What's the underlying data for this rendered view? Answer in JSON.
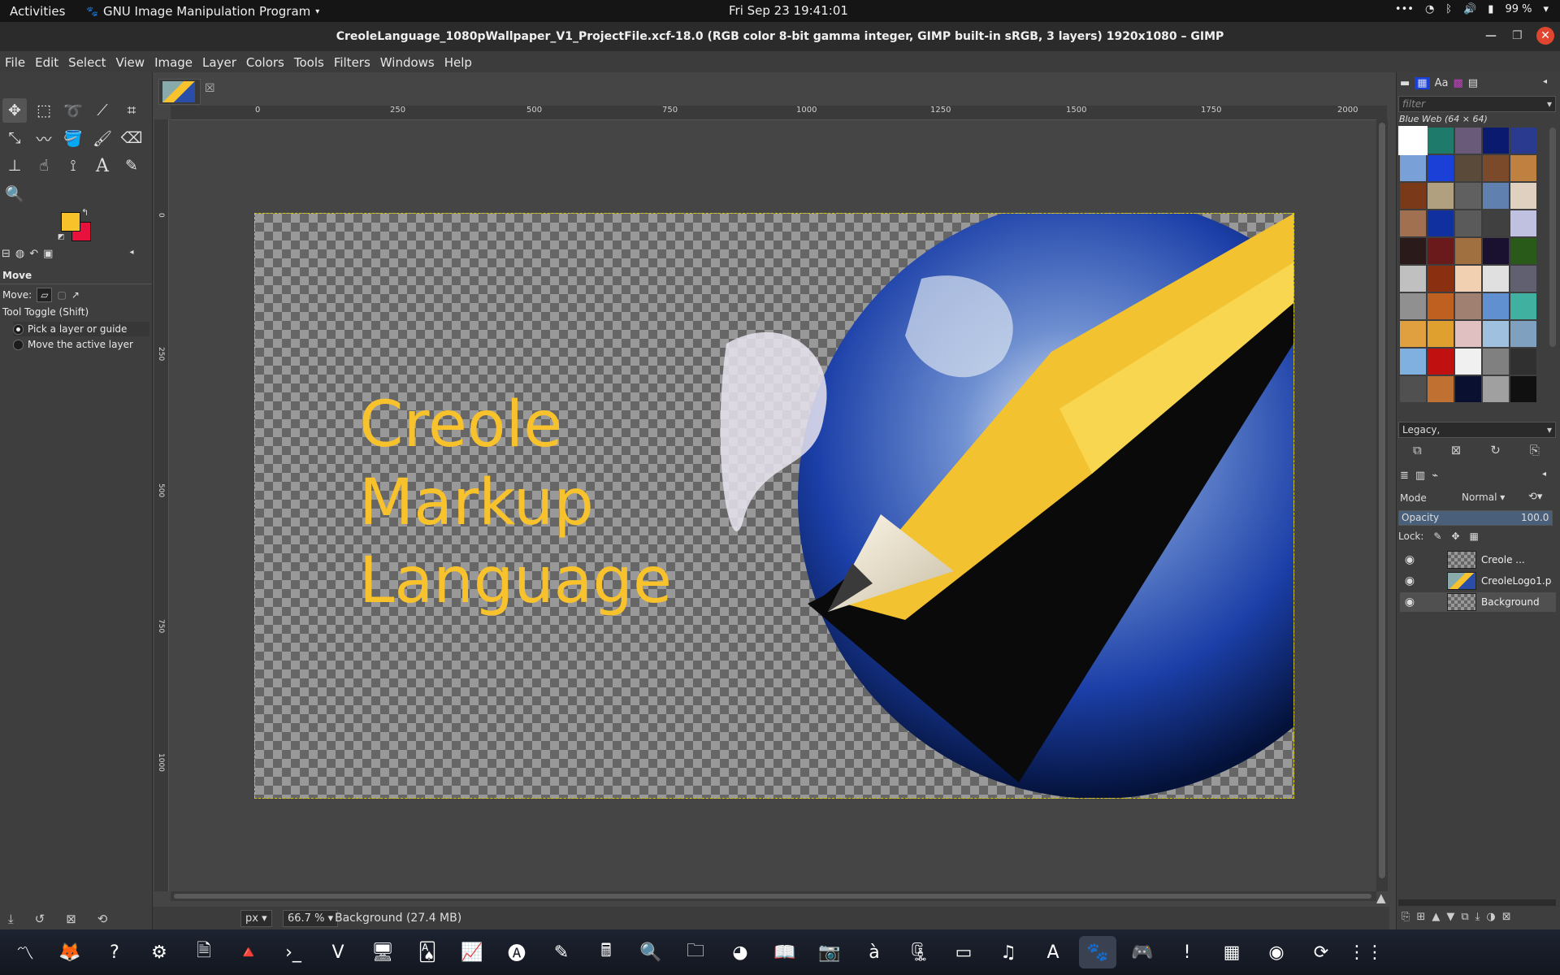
{
  "topbar": {
    "activities": "Activities",
    "app_name": "GNU Image Manipulation Program",
    "clock": "Fri Sep 23  19:41:01",
    "battery": "99 %"
  },
  "window": {
    "title": "CreoleLanguage_1080pWallpaper_V1_ProjectFile.xcf-18.0 (RGB color 8-bit gamma integer, GIMP built-in sRGB, 3 layers) 1920x1080 – GIMP"
  },
  "menubar": [
    "File",
    "Edit",
    "Select",
    "View",
    "Image",
    "Layer",
    "Colors",
    "Tools",
    "Filters",
    "Windows",
    "Help"
  ],
  "toolbox": {
    "foreground_color": "#f8c32a",
    "background_color": "#e8103c"
  },
  "tool_options": {
    "title": "Move",
    "move_label": "Move:",
    "tool_toggle": "Tool Toggle  (Shift)",
    "option_pick": "Pick a layer or guide",
    "option_move": "Move the active layer"
  },
  "ruler": {
    "top_labels": [
      "0",
      "250",
      "500",
      "750",
      "1000",
      "1250",
      "1500",
      "1750",
      "2000"
    ],
    "left_labels": [
      "0",
      "250",
      "500",
      "750",
      "1000"
    ]
  },
  "canvas": {
    "text_line1": "Creole",
    "text_line2": "Markup",
    "text_line3": "Language",
    "text_color": "#f7c22b"
  },
  "statusbar": {
    "unit": "px",
    "zoom": "66.7 %",
    "message": "Background (27.4 MB)"
  },
  "patterns_dock": {
    "filter_placeholder": "filter",
    "pattern_name": "Blue Web (64 × 64)",
    "tag": "Legacy,",
    "swatches": [
      "#ffffff",
      "#1e7a6a",
      "#6a5a7a",
      "#0a1a6e",
      "#2a3a8e",
      "#7aa0d8",
      "#1a40d8",
      "#5a4a3a",
      "#7a4a2a",
      "#c08040",
      "#7a3a1a",
      "#b0a080",
      "#606060",
      "#6080b0",
      "#e0d0c0",
      "#a07050",
      "#1030a0",
      "#5a5a5a",
      "#404040",
      "#c0c0e0",
      "#2a1a1a",
      "#6a1a1a",
      "#a07040",
      "#1a1030",
      "#2a5a1a",
      "#c0c0c0",
      "#8a3010",
      "#f0d0b0",
      "#e0e0e0",
      "#606070",
      "#909090",
      "#c06020",
      "#a08070",
      "#6090d0",
      "#40b0a0",
      "#e0a040",
      "#e0a030",
      "#e0c0c0",
      "#a0c0e0",
      "#80a0c0",
      "#80b0e0",
      "#c01010",
      "#f0f0f0",
      "#808080",
      "#303030",
      "#505050",
      "#c07030",
      "#0a1030",
      "#a0a0a0",
      "#101010"
    ]
  },
  "layers_dock": {
    "mode_label": "Mode",
    "mode_value": "Normal",
    "opacity_label": "Opacity",
    "opacity_value": "100.0",
    "lock_label": "Lock:",
    "layers": [
      "Creole ...",
      "CreoleLogo1.p",
      "Background"
    ]
  },
  "taskbar": {
    "apps": [
      "system-monitor-icon",
      "firefox-icon",
      "help-icon",
      "settings-icon",
      "writer-icon",
      "vlc-icon",
      "terminal-icon",
      "vim-icon",
      "remote-desktop-icon",
      "solitaire-icon",
      "sysmonitor-graph-icon",
      "software-center-icon",
      "text-editor-icon",
      "calculator-icon",
      "image-viewer-icon",
      "files-icon",
      "disk-usage-icon",
      "okular-icon",
      "screenshot-icon",
      "character-map-icon",
      "archive-icon",
      "virtual-desktop-icon",
      "music-icon",
      "pdf-viewer-icon",
      "gimp-icon",
      "game-icon",
      "alert-icon",
      "spreadsheet-icon",
      "camera-icon",
      "update-icon",
      "app-grid-icon"
    ]
  }
}
